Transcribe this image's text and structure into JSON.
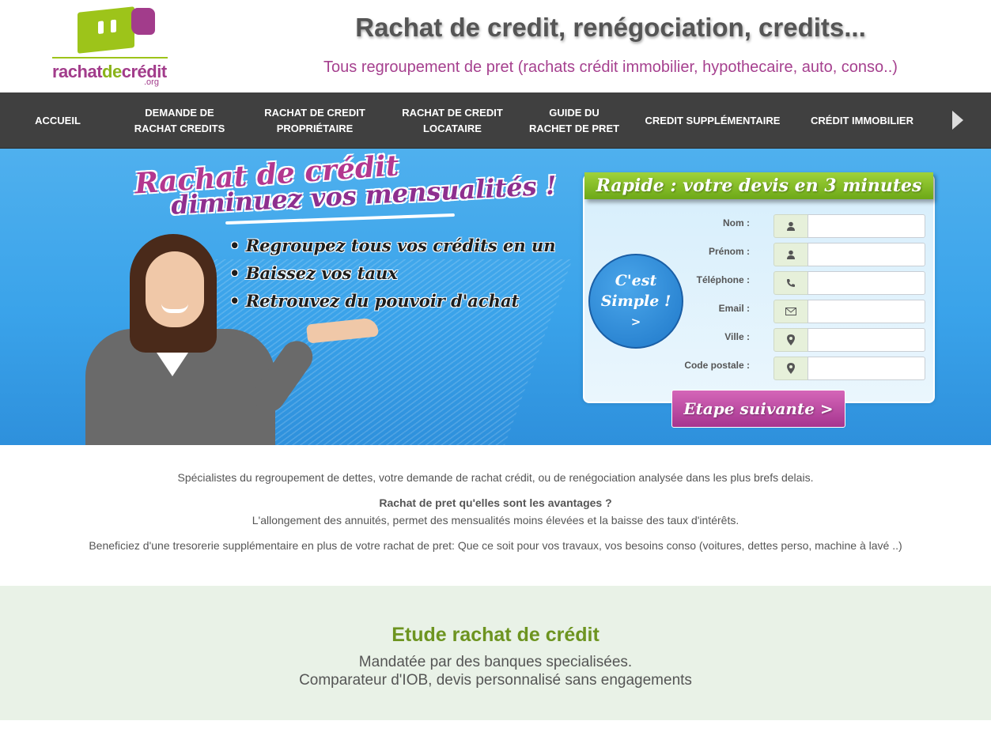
{
  "header": {
    "logo_text_a": "rachat",
    "logo_text_b": "de",
    "logo_text_c": "crédit",
    "logo_org": ".org",
    "title": "Rachat de credit, renégociation, credits...",
    "subtitle": "Tous regroupement de pret (rachats crédit immobilier, hypothecaire, auto, conso..)"
  },
  "nav": {
    "items": [
      {
        "line1": "ACCUEIL",
        "line2": ""
      },
      {
        "line1": "DEMANDE DE",
        "line2": "RACHAT CREDITS"
      },
      {
        "line1": "RACHAT DE CREDIT",
        "line2": "PROPRIÉTAIRE"
      },
      {
        "line1": "RACHAT DE CREDIT",
        "line2": "LOCATAIRE"
      },
      {
        "line1": "GUIDE DU",
        "line2": "RACHET DE PRET"
      },
      {
        "line1": "CREDIT SUPPLÉMENTAIRE",
        "line2": ""
      },
      {
        "line1": "CRÉDIT IMMOBILIER",
        "line2": ""
      }
    ],
    "next_icon": "chevron-right-icon"
  },
  "hero": {
    "headline_1": "Rachat de crédit",
    "headline_2": "diminuez vos mensualités !",
    "bullets": [
      "Regroupez tous vos crédits en un",
      "Baissez vos taux",
      "Retrouvez du pouvoir d'achat"
    ]
  },
  "form": {
    "banner": "Rapide : votre devis en 3 minutes",
    "badge_line1": "C'est",
    "badge_line2": "Simple !",
    "badge_arrow": ">",
    "fields": [
      {
        "label": "Nom :",
        "icon": "user-icon",
        "value": ""
      },
      {
        "label": "Prénom :",
        "icon": "user-icon",
        "value": ""
      },
      {
        "label": "Téléphone :",
        "icon": "phone-icon",
        "value": ""
      },
      {
        "label": "Email :",
        "icon": "envelope-icon",
        "value": ""
      },
      {
        "label": "Ville :",
        "icon": "map-marker-icon",
        "value": ""
      },
      {
        "label": "Code postale :",
        "icon": "map-marker-icon",
        "value": ""
      }
    ],
    "submit_label": "Etape suivante >"
  },
  "intro": {
    "p1": "Spécialistes du regroupement de dettes, votre demande de rachat crédit, ou de renégociation analysée dans les plus brefs delais.",
    "p2_title": "Rachat de pret qu'elles sont les avantages ?",
    "p2_body": "L'allongement des annuités, permet des mensualités moins élevées et la baisse des taux d'intérêts.",
    "p3": "Beneficiez d'une tresorerie supplémentaire en plus de votre rachat de pret: Que ce soit pour vos travaux, vos besoins conso (voitures, dettes perso, machine à lavé ..)"
  },
  "study": {
    "title": "Etude rachat de crédit",
    "line1": "Mandatée par des banques specialisées.",
    "line2": "Comparateur d'IOB, devis personnalisé sans engagements"
  },
  "colors": {
    "brand_purple": "#a6418f",
    "brand_green": "#8ab31a",
    "nav_bg": "#404040",
    "hero_blue": "#3aa3ea"
  }
}
